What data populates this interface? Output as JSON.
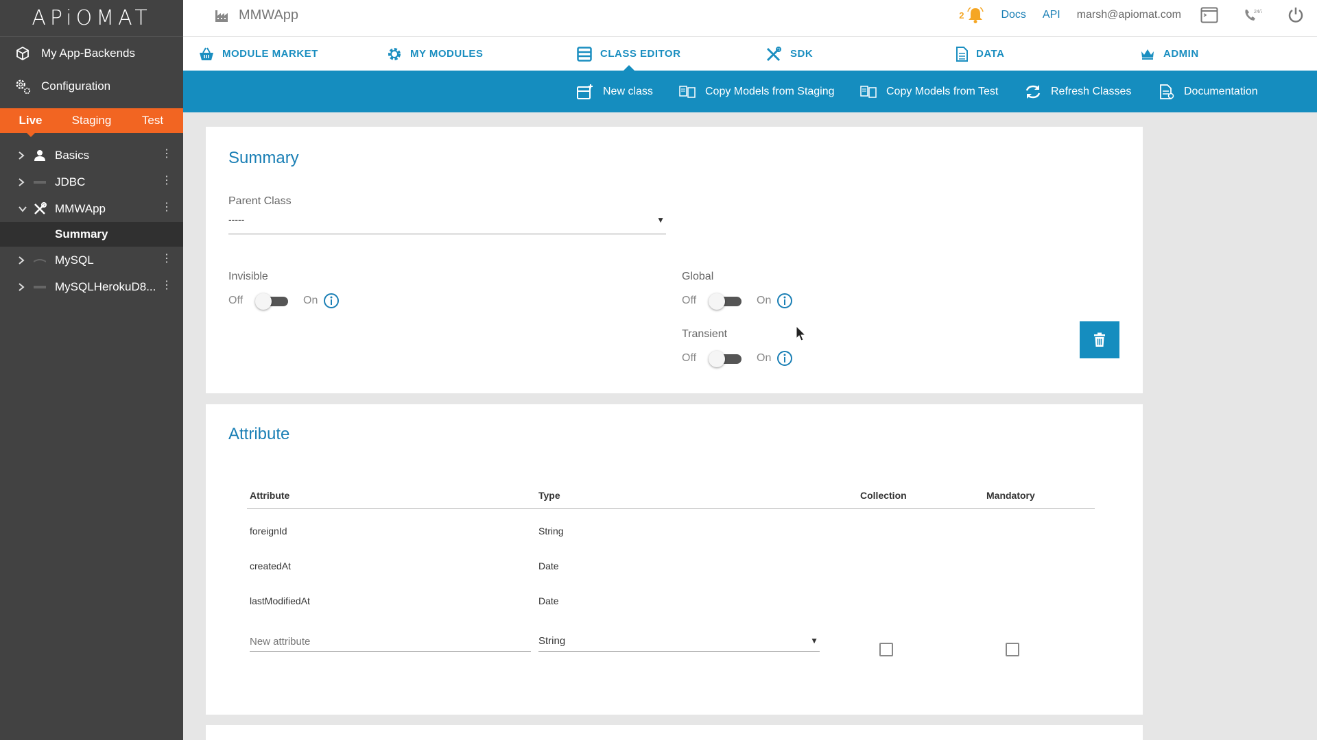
{
  "sidebar": {
    "logo": "APiOMAT",
    "links": [
      {
        "label": "My App-Backends",
        "icon": "cube-icon"
      },
      {
        "label": "Configuration",
        "icon": "gears-icon"
      }
    ],
    "env_tabs": [
      "Live",
      "Staging",
      "Test"
    ],
    "active_env": "Live",
    "tree": [
      {
        "label": "Basics",
        "icon": "person-icon",
        "expanded": false
      },
      {
        "label": "JDBC",
        "icon": "jdbc-icon",
        "expanded": false
      },
      {
        "label": "MMWApp",
        "icon": "tools-icon",
        "expanded": true
      },
      {
        "label": "MySQL",
        "icon": "mysql-icon",
        "expanded": false
      },
      {
        "label": "MySQLHerokuD8...",
        "icon": "jdbc-icon",
        "expanded": false
      }
    ],
    "selected_child": "Summary"
  },
  "header": {
    "app_title": "MMWApp",
    "notification_count": "2",
    "docs": "Docs",
    "api": "API",
    "user_email": "marsh@apiomat.com"
  },
  "module_tabs": [
    {
      "label": "MODULE MARKET",
      "icon": "basket-icon"
    },
    {
      "label": "MY MODULES",
      "icon": "gear-icon"
    },
    {
      "label": "CLASS EDITOR",
      "icon": "class-editor-icon"
    },
    {
      "label": "SDK",
      "icon": "tools-icon"
    },
    {
      "label": "DATA",
      "icon": "document-icon"
    },
    {
      "label": "ADMIN",
      "icon": "crown-icon"
    }
  ],
  "active_module_tab": "CLASS EDITOR",
  "actions": [
    {
      "label": "New class",
      "icon": "new-class-icon"
    },
    {
      "label": "Copy Models from Staging",
      "icon": "copy-models-icon"
    },
    {
      "label": "Copy Models from Test",
      "icon": "copy-models-icon"
    },
    {
      "label": "Refresh Classes",
      "icon": "refresh-icon"
    },
    {
      "label": "Documentation",
      "icon": "documentation-icon"
    }
  ],
  "summary": {
    "title": "Summary",
    "parent_class_label": "Parent Class",
    "parent_class_value": "-----",
    "toggles": {
      "invisible": {
        "label": "Invisible",
        "off": "Off",
        "on": "On",
        "checked": false
      },
      "global": {
        "label": "Global",
        "off": "Off",
        "on": "On",
        "checked": false
      },
      "transient": {
        "label": "Transient",
        "off": "Off",
        "on": "On",
        "checked": false
      }
    }
  },
  "attribute": {
    "title": "Attribute",
    "columns": [
      "Attribute",
      "Type",
      "Collection",
      "Mandatory"
    ],
    "rows": [
      {
        "name": "foreignId",
        "type": "String"
      },
      {
        "name": "createdAt",
        "type": "Date"
      },
      {
        "name": "lastModifiedAt",
        "type": "Date"
      }
    ],
    "new_attribute_placeholder": "New attribute",
    "new_type_value": "String",
    "new_collection_checked": false,
    "new_mandatory_checked": false
  },
  "colors": {
    "brand_blue": "#158dbf",
    "env_orange": "#f26522",
    "sidebar": "#424242",
    "bell": "#f5a623"
  }
}
